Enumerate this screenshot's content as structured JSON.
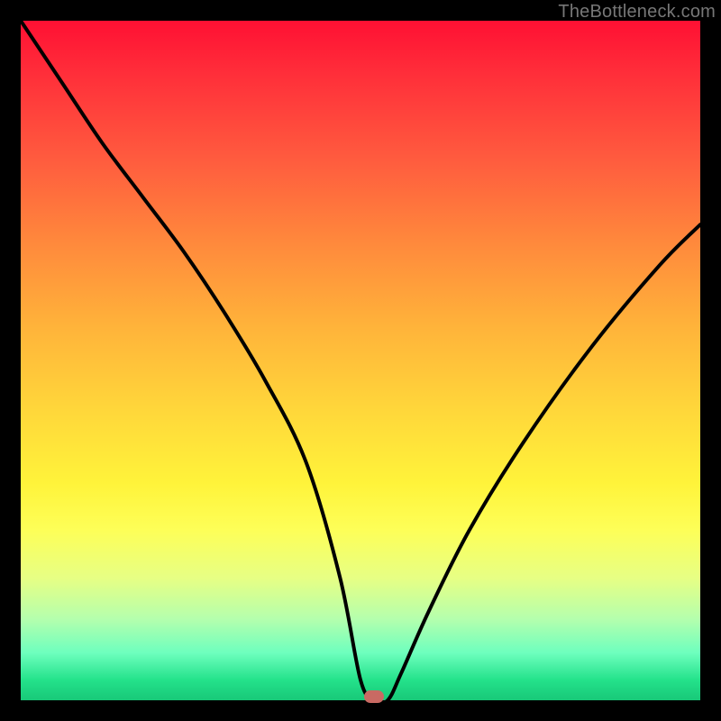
{
  "watermark": "TheBottleneck.com",
  "chart_data": {
    "type": "line",
    "title": "",
    "xlabel": "",
    "ylabel": "",
    "xlim": [
      0,
      100
    ],
    "ylim": [
      0,
      100
    ],
    "grid": false,
    "legend": false,
    "annotations": [
      {
        "kind": "marker",
        "x": 52,
        "y": 0.5,
        "color": "#c96a63"
      }
    ],
    "series": [
      {
        "name": "bottleneck-curve",
        "x": [
          0,
          6,
          12,
          18,
          24,
          30,
          36,
          42,
          47,
          50,
          52,
          54,
          56,
          60,
          66,
          74,
          84,
          94,
          100
        ],
        "y": [
          100,
          91,
          82,
          74,
          66,
          57,
          47,
          35,
          18,
          3,
          0,
          0,
          4,
          13,
          25,
          38,
          52,
          64,
          70
        ]
      }
    ],
    "background_gradient": {
      "direction": "vertical",
      "stops": [
        {
          "pos": 0.0,
          "color": "#ff1033"
        },
        {
          "pos": 0.08,
          "color": "#ff2f3a"
        },
        {
          "pos": 0.2,
          "color": "#ff5a3e"
        },
        {
          "pos": 0.33,
          "color": "#ff8a3c"
        },
        {
          "pos": 0.45,
          "color": "#ffb33a"
        },
        {
          "pos": 0.57,
          "color": "#ffd63a"
        },
        {
          "pos": 0.68,
          "color": "#fff33a"
        },
        {
          "pos": 0.75,
          "color": "#fdff58"
        },
        {
          "pos": 0.82,
          "color": "#e7ff84"
        },
        {
          "pos": 0.88,
          "color": "#b5ffad"
        },
        {
          "pos": 0.93,
          "color": "#6effbe"
        },
        {
          "pos": 0.97,
          "color": "#24e28b"
        },
        {
          "pos": 1.0,
          "color": "#18c878"
        }
      ]
    }
  }
}
